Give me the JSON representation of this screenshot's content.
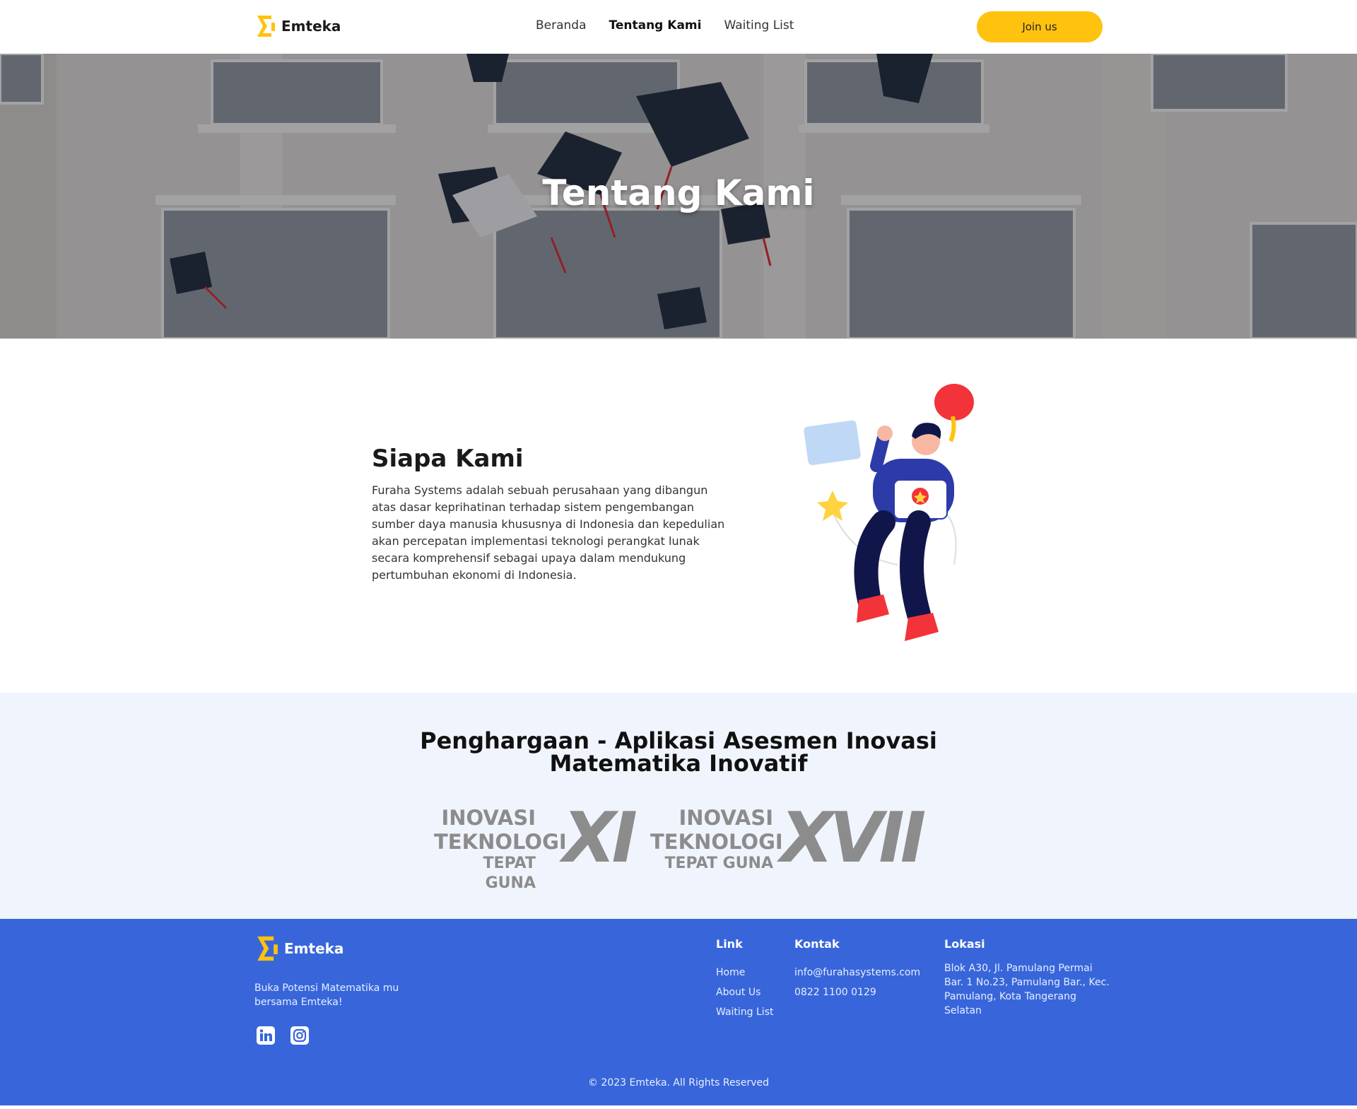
{
  "header": {
    "brand": "Emteka",
    "nav": [
      {
        "label": "Beranda"
      },
      {
        "label": "Tentang Kami",
        "active": true
      },
      {
        "label": "Waiting List"
      }
    ],
    "join_label": "Join us"
  },
  "hero": {
    "title": "Tentang Kami"
  },
  "about": {
    "title": "Siapa Kami",
    "text": "Furaha Systems adalah sebuah perusahaan yang dibangun atas dasar keprihatinan terhadap sistem pengembangan sumber daya manusia khususnya di Indonesia dan kepedulian akan percepatan implementasi teknologi perangkat lunak secara komprehensif sebagai upaya dalam mendukung pertumbuhan ekonomi di Indonesia."
  },
  "awards": {
    "title": "Penghargaan - Aplikasi Asesmen Inovasi Matematika Inovatif",
    "logos": [
      {
        "line1": "INOVASI",
        "line2": "TEKNOLOGI",
        "line3": "TEPAT GUNA",
        "number": "XI"
      },
      {
        "line1": "INOVASI",
        "line2": "TEKNOLOGI",
        "line3": "TEPAT GUNA",
        "number": "XVII"
      }
    ]
  },
  "footer": {
    "brand": "Emteka",
    "tagline": "Buka Potensi Matematika mu bersama Emteka!",
    "social": [
      "linkedin-icon",
      "instagram-icon"
    ],
    "link_title": "Link",
    "links": [
      "Home",
      "About Us",
      "Waiting List"
    ],
    "contact_title": "Kontak",
    "email": "info@furahasystems.com",
    "phone": "0822 1100 0129",
    "location_title": "Lokasi",
    "address": "Blok A30, Jl. Pamulang Permai Bar. 1 No.23, Pamulang Bar., Kec. Pamulang, Kota Tangerang Selatan",
    "copyright": "© 2023 Emteka. All Rights Reserved"
  },
  "colors": {
    "accent": "#FFC20E",
    "footer": "#3866DA",
    "awards_bg": "#F0F5FD"
  }
}
